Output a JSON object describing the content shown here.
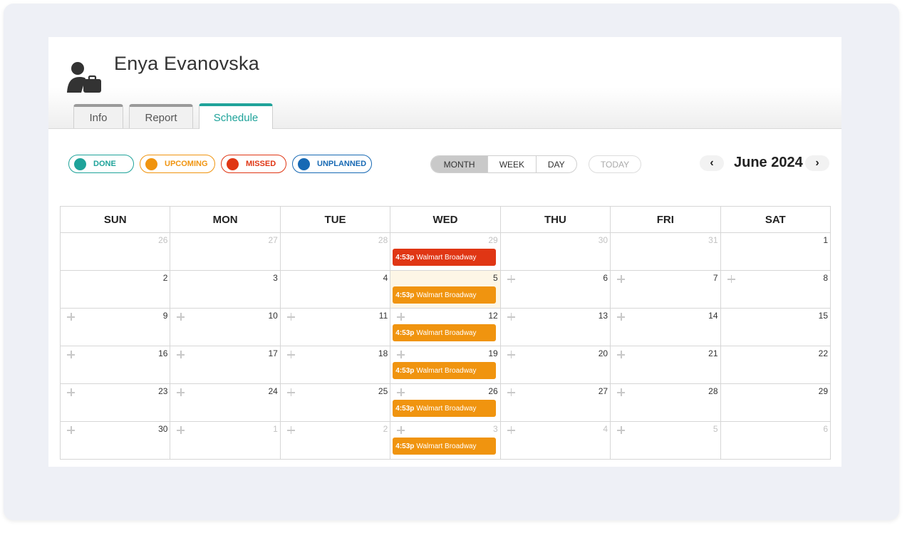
{
  "person": {
    "name": "Enya Evanovska",
    "avatar_icon": "person-briefcase-icon"
  },
  "tabs": [
    {
      "label": "Info",
      "active": false
    },
    {
      "label": "Report",
      "active": false
    },
    {
      "label": "Schedule",
      "active": true
    }
  ],
  "legend": [
    {
      "label": "DONE",
      "color": "#1fa39a"
    },
    {
      "label": "UPCOMING",
      "color": "#f0940f"
    },
    {
      "label": "MISSED",
      "color": "#e03614"
    },
    {
      "label": "UNPLANNED",
      "color": "#1769b4"
    }
  ],
  "view_buttons": [
    {
      "label": "MONTH",
      "selected": true
    },
    {
      "label": "WEEK",
      "selected": false
    },
    {
      "label": "DAY",
      "selected": false
    }
  ],
  "today_label": "TODAY",
  "nav": {
    "prev_icon": "‹",
    "next_icon": "›",
    "month_label": "June 2024"
  },
  "weekdays": [
    "SUN",
    "MON",
    "TUE",
    "WED",
    "THU",
    "FRI",
    "SAT"
  ],
  "weeks": [
    [
      {
        "day": "26",
        "muted": true,
        "add": false
      },
      {
        "day": "27",
        "muted": true,
        "add": false
      },
      {
        "day": "28",
        "muted": true,
        "add": false
      },
      {
        "day": "29",
        "muted": true,
        "add": false,
        "event": {
          "time": "4:53p",
          "title": "Walmart Broadway",
          "status": "missed"
        }
      },
      {
        "day": "30",
        "muted": true,
        "add": false
      },
      {
        "day": "31",
        "muted": true,
        "add": false
      },
      {
        "day": "1",
        "muted": false,
        "add": false
      }
    ],
    [
      {
        "day": "2",
        "muted": false,
        "add": false
      },
      {
        "day": "3",
        "muted": false,
        "add": false
      },
      {
        "day": "4",
        "muted": false,
        "add": false
      },
      {
        "day": "5",
        "muted": false,
        "add": false,
        "today": true,
        "event": {
          "time": "4:53p",
          "title": "Walmart Broadway",
          "status": "upcoming"
        }
      },
      {
        "day": "6",
        "muted": false,
        "add": true
      },
      {
        "day": "7",
        "muted": false,
        "add": true
      },
      {
        "day": "8",
        "muted": false,
        "add": true
      }
    ],
    [
      {
        "day": "9",
        "muted": false,
        "add": true
      },
      {
        "day": "10",
        "muted": false,
        "add": true
      },
      {
        "day": "11",
        "muted": false,
        "add": true
      },
      {
        "day": "12",
        "muted": false,
        "add": true,
        "event": {
          "time": "4:53p",
          "title": "Walmart Broadway",
          "status": "upcoming"
        }
      },
      {
        "day": "13",
        "muted": false,
        "add": true
      },
      {
        "day": "14",
        "muted": false,
        "add": true
      },
      {
        "day": "15",
        "muted": false,
        "add": false
      }
    ],
    [
      {
        "day": "16",
        "muted": false,
        "add": true
      },
      {
        "day": "17",
        "muted": false,
        "add": true
      },
      {
        "day": "18",
        "muted": false,
        "add": true
      },
      {
        "day": "19",
        "muted": false,
        "add": true,
        "event": {
          "time": "4:53p",
          "title": "Walmart Broadway",
          "status": "upcoming"
        }
      },
      {
        "day": "20",
        "muted": false,
        "add": true
      },
      {
        "day": "21",
        "muted": false,
        "add": true
      },
      {
        "day": "22",
        "muted": false,
        "add": false
      }
    ],
    [
      {
        "day": "23",
        "muted": false,
        "add": true
      },
      {
        "day": "24",
        "muted": false,
        "add": true
      },
      {
        "day": "25",
        "muted": false,
        "add": true
      },
      {
        "day": "26",
        "muted": false,
        "add": true,
        "event": {
          "time": "4:53p",
          "title": "Walmart Broadway",
          "status": "upcoming"
        }
      },
      {
        "day": "27",
        "muted": false,
        "add": true
      },
      {
        "day": "28",
        "muted": false,
        "add": true
      },
      {
        "day": "29",
        "muted": false,
        "add": false
      }
    ],
    [
      {
        "day": "30",
        "muted": false,
        "add": true
      },
      {
        "day": "1",
        "muted": true,
        "add": true
      },
      {
        "day": "2",
        "muted": true,
        "add": true
      },
      {
        "day": "3",
        "muted": true,
        "add": true,
        "event": {
          "time": "4:53p",
          "title": "Walmart Broadway",
          "status": "upcoming"
        }
      },
      {
        "day": "4",
        "muted": true,
        "add": true
      },
      {
        "day": "5",
        "muted": true,
        "add": true
      },
      {
        "day": "6",
        "muted": true,
        "add": false
      }
    ]
  ],
  "status_colors": {
    "missed": "#e03614",
    "upcoming": "#f0940f",
    "done": "#1fa39a",
    "unplanned": "#1769b4"
  }
}
